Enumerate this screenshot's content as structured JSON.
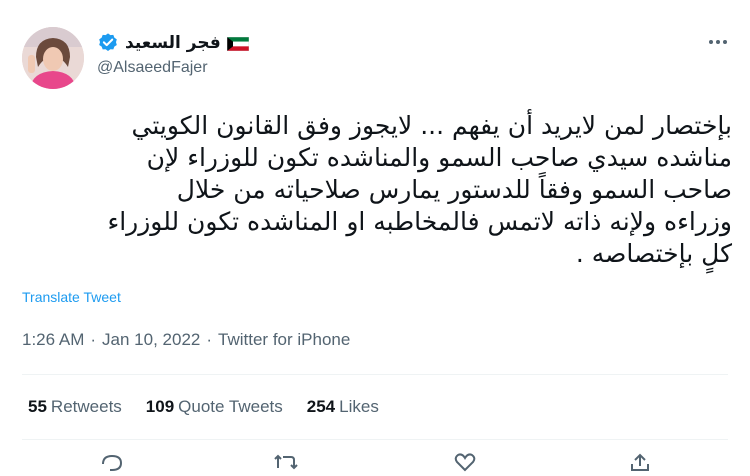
{
  "author": {
    "display_name": "فجر السعيد",
    "handle": "@AlsaeedFajer",
    "verified_icon": "verified-badge-icon",
    "flag_icon": "kuwait-flag-icon"
  },
  "tweet": {
    "lines": [
      "بإختصار لمن لايريد أن يفهم ... لايجوز وفق القانون الكويتي",
      "مناشده سيدي صاحب السمو والمناشده تكون للوزراء لإن",
      "صاحب السمو وفقاً للدستور يمارس صلاحياته من خلال",
      "وزراءه ولإنه ذاته لاتمس فالمخاطبه او المناشده تكون للوزراء",
      "كلٍ بإختصاصه ."
    ],
    "translate_label": "Translate Tweet"
  },
  "meta": {
    "time": "1:26 AM",
    "separator": "·",
    "date": "Jan 10, 2022",
    "source": "Twitter for iPhone"
  },
  "stats": [
    {
      "count": "55",
      "label": "Retweets"
    },
    {
      "count": "109",
      "label": "Quote Tweets"
    },
    {
      "count": "254",
      "label": "Likes"
    }
  ],
  "colors": {
    "link": "#1d9bf0",
    "secondary_text": "#536471",
    "divider": "#eff3f4"
  }
}
